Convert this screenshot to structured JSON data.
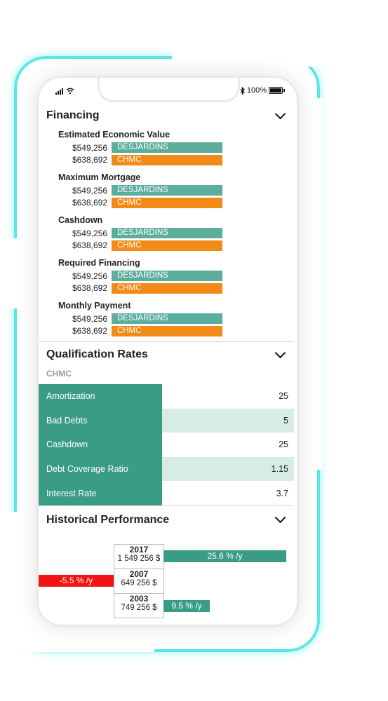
{
  "status": {
    "battery": "100%"
  },
  "financing": {
    "title": "Financing",
    "groups": [
      {
        "label": "Estimated Economic Value",
        "desj_value": "$549,256",
        "desj_label": "DESJARDINS",
        "chmc_value": "$638,692",
        "chmc_label": "CHMC"
      },
      {
        "label": "Maximum Mortgage",
        "desj_value": "$549,256",
        "desj_label": "DESJARDINS",
        "chmc_value": "$638,692",
        "chmc_label": "CHMC"
      },
      {
        "label": "Cashdown",
        "desj_value": "$549,256",
        "desj_label": "DESJARDINS",
        "chmc_value": "$638,692",
        "chmc_label": "CHMC"
      },
      {
        "label": "Required Financing",
        "desj_value": "$549,256",
        "desj_label": "DESJARDINS",
        "chmc_value": "$638,692",
        "chmc_label": "CHMC"
      },
      {
        "label": "Monthly Payment",
        "desj_value": "$549,256",
        "desj_label": "DESJARDINS",
        "chmc_value": "$638,692",
        "chmc_label": "CHMC"
      }
    ]
  },
  "qualification": {
    "title": "Qualification Rates",
    "subtitle": "CHMC",
    "rows": [
      {
        "label": "Amortization",
        "value": "25"
      },
      {
        "label": "Bad Debts",
        "value": "5"
      },
      {
        "label": "Cashdown",
        "value": "25"
      },
      {
        "label": "Debt Coverage Ratio",
        "value": "1.15"
      },
      {
        "label": "Interest Rate",
        "value": "3.7"
      }
    ]
  },
  "historical": {
    "title": "Historical Performance",
    "entries": [
      {
        "year": "2017",
        "amount": "1 549 256 $",
        "rate": "25.6 % /y"
      },
      {
        "year": "2007",
        "amount": "649 256 $",
        "rate": "-5.5 % /y"
      },
      {
        "year": "2003",
        "amount": "749 256 $",
        "rate": "9.5 % /y"
      }
    ]
  },
  "colors": {
    "desjardins": "#5bae9c",
    "chmc": "#f28a17",
    "teal_dark": "#3a9c84",
    "negative": "#f21414",
    "glow": "#5ce7e6"
  }
}
